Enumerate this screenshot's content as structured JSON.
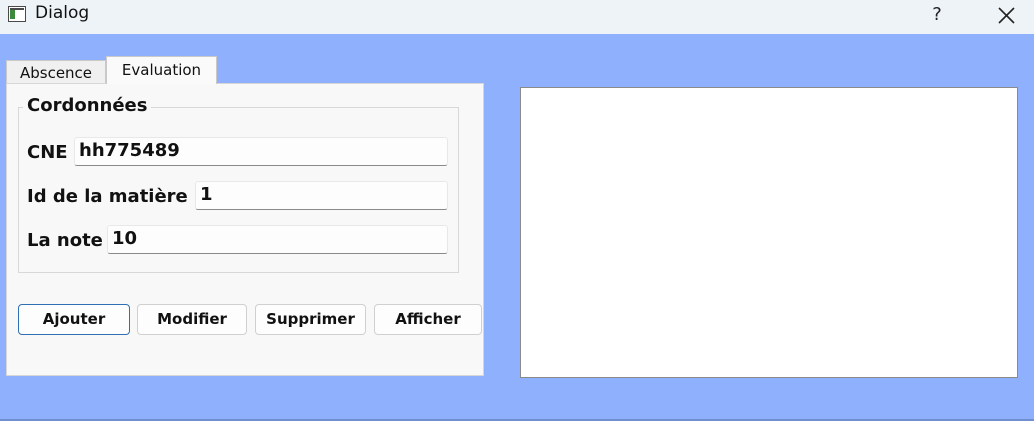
{
  "window": {
    "title": "Dialog",
    "help_label": "?",
    "icons": {
      "app": "app-window-icon",
      "close": "close-icon"
    }
  },
  "tabs": [
    {
      "label": "Abscence",
      "active": false
    },
    {
      "label": "Evaluation",
      "active": true
    }
  ],
  "form": {
    "group_title": "Cordonnées",
    "fields": {
      "cne": {
        "label": "CNE",
        "value": "hh775489"
      },
      "matiere": {
        "label": "Id de la matière",
        "value": "1"
      },
      "note": {
        "label": "La note",
        "value": "10"
      }
    }
  },
  "buttons": {
    "add": "Ajouter",
    "edit": "Modifier",
    "delete": "Supprimer",
    "show": "Afficher"
  },
  "colors": {
    "background": "#8fb0fd",
    "titlebar": "#eef3f8",
    "default_button_border": "#2f6fb4"
  }
}
